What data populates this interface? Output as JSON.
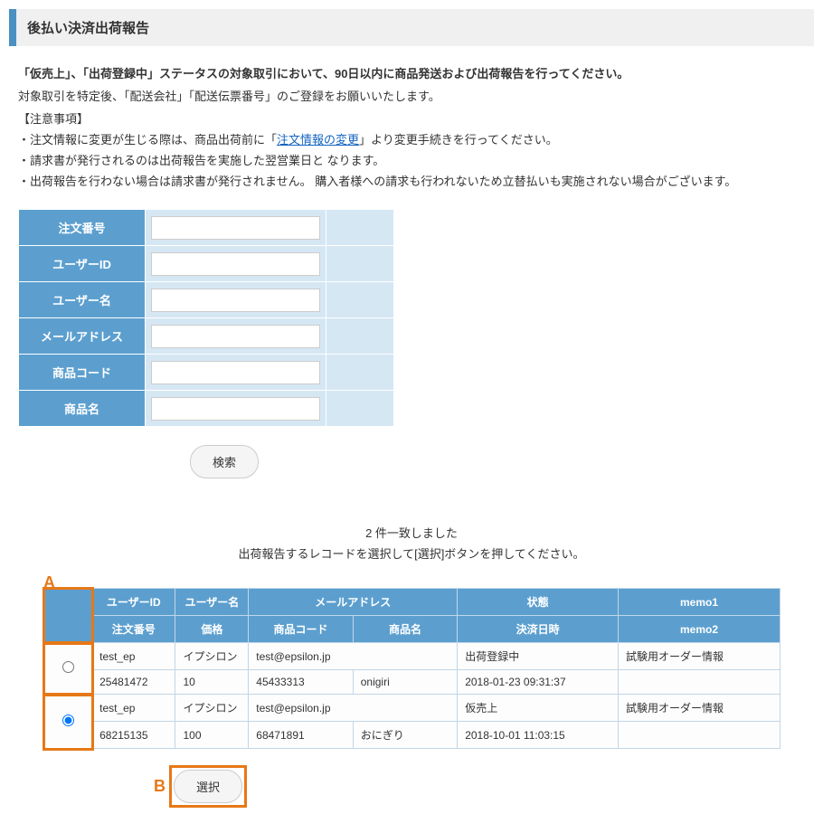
{
  "page_title": "後払い決済出荷報告",
  "intro": {
    "bold": "「仮売上」、「出荷登録中」ステータスの対象取引において、90日以内に商品発送および出荷報告を行ってください。",
    "line1": "対象取引を特定後、「配送会社」「配送伝票番号」のご登録をお願いいたします。",
    "notice_label": "【注意事項】",
    "notice1_pre": "・注文情報に変更が生じる際は、商品出荷前に「",
    "notice1_link": "注文情報の変更",
    "notice1_post": "」より変更手続きを行ってください。",
    "notice2": "・請求書が発行されるのは出荷報告を実施した翌営業日と なります。",
    "notice3": "・出荷報告を行わない場合は請求書が発行されません。 購入者様への請求も行われないため立替払いも実施されない場合がございます。"
  },
  "search": {
    "fields": {
      "order_no": "注文番号",
      "user_id": "ユーザーID",
      "user_name": "ユーザー名",
      "email": "メールアドレス",
      "product_code": "商品コード",
      "product_name": "商品名"
    },
    "button": "検索"
  },
  "results": {
    "count_text": "2 件一致しました",
    "hint": "出荷報告するレコードを選択して[選択]ボタンを押してください。",
    "callout_a": "A",
    "callout_b": "B",
    "headers": {
      "user_id": "ユーザーID",
      "user_name": "ユーザー名",
      "email": "メールアドレス",
      "status": "状態",
      "memo1": "memo1",
      "order_no": "注文番号",
      "price": "価格",
      "product_code": "商品コード",
      "product_name": "商品名",
      "settle_date": "決済日時",
      "memo2": "memo2"
    },
    "rows": [
      {
        "user_id": "test_ep",
        "user_name": "イプシロン",
        "email": "test@epsilon.jp",
        "status": "出荷登録中",
        "memo1": "試験用オーダー情報",
        "order_no": "25481472",
        "price": "10",
        "product_code": "45433313",
        "product_name": "onigiri",
        "settle_date": "2018-01-23 09:31:37",
        "memo2": "",
        "selected": false
      },
      {
        "user_id": "test_ep",
        "user_name": "イプシロン",
        "email": "test@epsilon.jp",
        "status": "仮売上",
        "memo1": "試験用オーダー情報",
        "order_no": "68215135",
        "price": "100",
        "product_code": "68471891",
        "product_name": "おにぎり",
        "settle_date": "2018-10-01 11:03:15",
        "memo2": "",
        "selected": true
      }
    ],
    "select_button": "選択"
  }
}
